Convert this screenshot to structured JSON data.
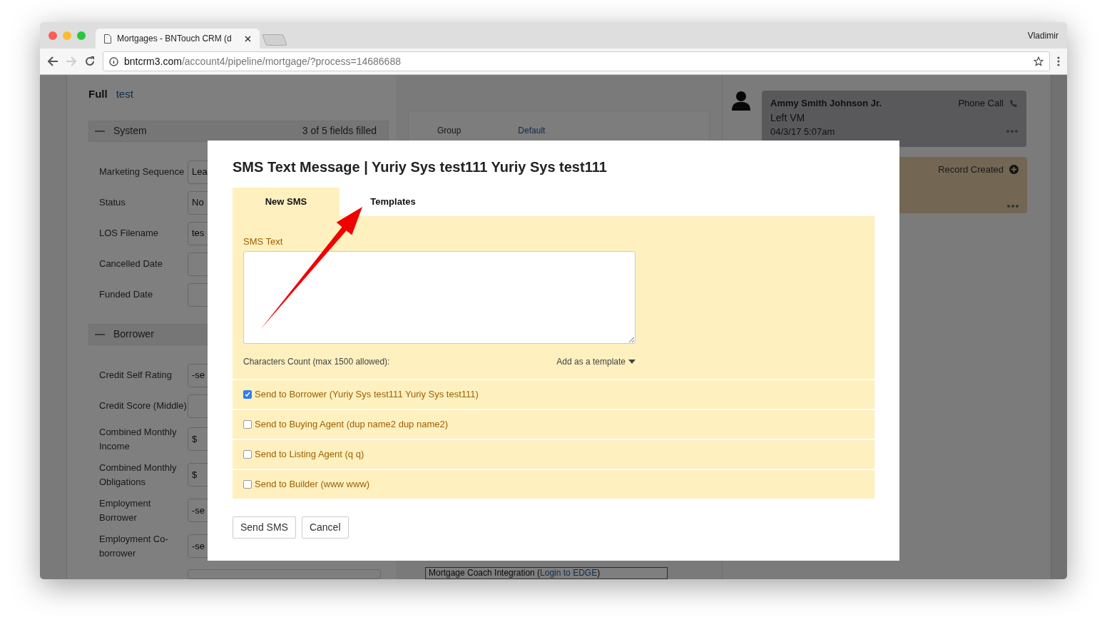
{
  "browser": {
    "tabs": [
      {
        "title": "Mortgages - BNTouch CRM (d",
        "selected": true
      }
    ],
    "profile": "Vladimir",
    "url": {
      "host": "bntcrm3.com",
      "path": "/account4/pipeline/mortgage/?process=14686688"
    }
  },
  "page": {
    "header": {
      "title": "Full",
      "link": "test"
    },
    "sections": [
      {
        "title": "System",
        "summary": "3 of 5 fields filled",
        "expanded": true,
        "fields": [
          {
            "label": "Marketing Sequence",
            "value": "Lea"
          },
          {
            "label": "Status",
            "value": "No"
          },
          {
            "label": "LOS Filename",
            "value": "tes"
          },
          {
            "label": "Cancelled Date"
          },
          {
            "label": "Funded Date"
          }
        ]
      },
      {
        "title": "Borrower",
        "expanded": true,
        "fields": [
          {
            "label": "Credit Self Rating",
            "value": "-se"
          },
          {
            "label": "Credit Score (Middle)"
          },
          {
            "label": "Combined Monthly Income",
            "value": "$"
          },
          {
            "label": "Combined Monthly Obligations",
            "value": "$"
          },
          {
            "label": "Employment Borrower",
            "value": "-se"
          },
          {
            "label": "Employment Co-borrower",
            "value": "-se"
          }
        ]
      }
    ],
    "middle": {
      "group_label": "Group",
      "group_value": "Default",
      "integration": {
        "text": "Mortgage Coach Integration (",
        "link": "Login to EDGE",
        "suffix": ")"
      }
    },
    "activity": [
      {
        "kind": "call",
        "name": "Ammy Smith Johnson Jr.",
        "type": "Phone Call",
        "note": "Left VM",
        "time": "04/3/17 5:07am"
      },
      {
        "kind": "record",
        "type": "Record Created"
      }
    ]
  },
  "modal": {
    "title": "SMS Text Message | Yuriy Sys test111 Yuriy Sys test111",
    "tabs": [
      {
        "label": "New SMS",
        "selected": true
      },
      {
        "label": "Templates",
        "selected": false
      }
    ],
    "field_label": "SMS Text",
    "counter": "Characters Count (max 1500 allowed):",
    "add_template": "Add as a template",
    "recipients": [
      {
        "label": "Send to Borrower (Yuriy Sys test111 Yuriy Sys test111)",
        "checked": true
      },
      {
        "label": "Send to Buying Agent (dup name2 dup name2)",
        "checked": false
      },
      {
        "label": "Send to Listing Agent (q q)",
        "checked": false
      },
      {
        "label": "Send to Builder (www www)",
        "checked": false
      }
    ],
    "buttons": [
      "Send SMS",
      "Cancel"
    ]
  }
}
